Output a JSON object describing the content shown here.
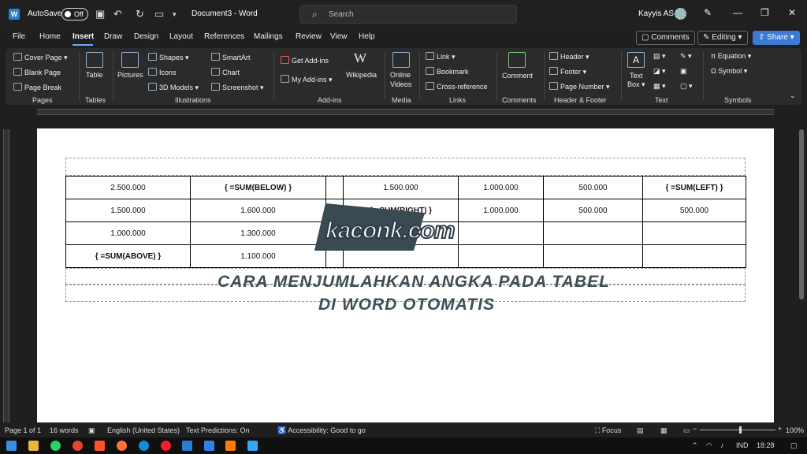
{
  "titlebar": {
    "autosave_label": "AutoSave",
    "autosave_state": "Off",
    "document_title": "Document3 - Word",
    "search_placeholder": "Search",
    "user_name": "Kayyis AS"
  },
  "menu": [
    "File",
    "Home",
    "Insert",
    "Draw",
    "Design",
    "Layout",
    "References",
    "Mailings",
    "Review",
    "View",
    "Help"
  ],
  "active_tab": "Insert",
  "header_buttons": {
    "comments": "Comments",
    "editing": "Editing",
    "share": "Share"
  },
  "ribbon": {
    "pages": {
      "label": "Pages",
      "items": [
        "Cover Page",
        "Blank Page",
        "Page Break"
      ]
    },
    "tables": {
      "label": "Tables",
      "item": "Table"
    },
    "illustrations": {
      "label": "Illustrations",
      "pictures": "Pictures",
      "items": [
        "Shapes",
        "Icons",
        "3D Models",
        "SmartArt",
        "Chart",
        "Screenshot"
      ]
    },
    "addins": {
      "label": "Add-ins",
      "items": [
        "Get Add-ins",
        "My Add-ins"
      ],
      "wikipedia": "Wikipedia"
    },
    "media": {
      "label": "Media",
      "online": "Online",
      "videos": "Videos"
    },
    "links": {
      "label": "Links",
      "items": [
        "Link",
        "Bookmark",
        "Cross-reference"
      ]
    },
    "comments": {
      "label": "Comments",
      "item": "Comment"
    },
    "header_footer": {
      "label": "Header & Footer",
      "items": [
        "Header",
        "Footer",
        "Page Number"
      ]
    },
    "text": {
      "label": "Text",
      "textbox1": "Text",
      "textbox2": "Box"
    },
    "symbols": {
      "label": "Symbols",
      "items": [
        "Equation",
        "Symbol"
      ]
    }
  },
  "table": {
    "rows": [
      [
        "2.500.000",
        "{ =SUM(BELOW) }",
        "",
        "1.500.000",
        "1.000.000",
        "500.000",
        "{ =SUM(LEFT) }"
      ],
      [
        "1.500.000",
        "1.600.000",
        "",
        "{ =SUM(RIGHT) }",
        "1.000.000",
        "500.000",
        "500.000"
      ],
      [
        "1.000.000",
        "1.300.000",
        "",
        "",
        "",
        "",
        ""
      ],
      [
        "{ =SUM(ABOVE) }",
        "1.100.000",
        "",
        "",
        "",
        "",
        ""
      ]
    ]
  },
  "watermark": {
    "logo_text": "kaconk.com",
    "line1": "CARA MENJUMLAHKAN ANGKA PADA TABEL",
    "line2": "DI WORD OTOMATIS"
  },
  "status": {
    "page": "Page 1 of 1",
    "words": "16 words",
    "language": "English (United States)",
    "predictions": "Text Predictions: On",
    "accessibility": "Accessibility: Good to go",
    "focus": "Focus",
    "zoom": "100%"
  },
  "taskbar": {
    "lang": "IND",
    "time": "18:28"
  }
}
